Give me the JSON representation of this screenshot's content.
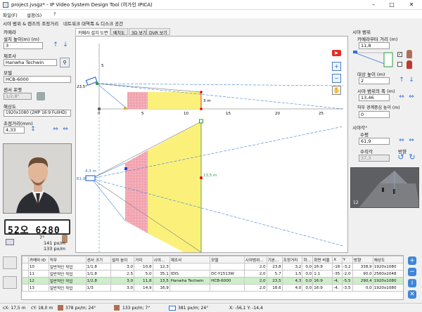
{
  "window": {
    "title": "project.jvsgz* - IP Video System Design Tool (어가인 IPICA)",
    "min": "–",
    "max": "□",
    "close": "✕"
  },
  "menu": [
    "파일(F)",
    "설정(S)",
    "?"
  ],
  "section_tabs": [
    "시야 범위 & 렌즈의 조정거리",
    "네트워크 대역폭 & 디스크 공간"
  ],
  "left": {
    "camera_title": "카메라",
    "install_height_label": "설치 높이(m) (m)",
    "install_height_value": "3",
    "maker_label": "제조사",
    "maker_value": "Hanwha Techwin",
    "model_label": "모델",
    "model_value": "HCB-6000",
    "sensor_label": "센서 포맷",
    "sensor_value": "1/2,8\"",
    "resolution_label": "해상도",
    "resolution_value": "1920x1080 (2MP 16:9 FullHD)",
    "focal_label": "초점거리(mm)",
    "focal_value": "4,33",
    "plate_text": "52오 6280",
    "preview_angle": "7°",
    "preview_density1": "141 px/m",
    "preview_density2": "133 px/m"
  },
  "view_tabs": [
    "카메라 설치 도면",
    "배치도",
    "3D 보기",
    "DVR 보기"
  ],
  "side_view": {
    "tilt_label": "23,5°",
    "height_tick": "5",
    "x_ticks": [
      "0",
      "5",
      "10",
      "15",
      "20",
      "25"
    ],
    "dist_label": "3 m"
  },
  "top_view": {
    "left_dist": "4,3 m",
    "left_angle": "61,9°",
    "width_label": "13,5 m"
  },
  "right": {
    "fov_title": "시야 범위",
    "cam_dist_label": "카메라부터 거리 (m)",
    "cam_dist_value": "11,8",
    "target_height_label": "대상 높이 (m)",
    "target_height_value": "2",
    "fov_width_label": "시야 범위의 폭 (m)",
    "fov_width_value": "13,46",
    "lower_boundary_label": "하부 경계중심 높이 (m)",
    "lower_boundary_value": "0",
    "angle_title": "시야각°",
    "horizontal_label": "수평",
    "horizontal_value": "61,9",
    "vertical_label": "수직각",
    "vertical_value": "37,3",
    "direction_label": "방향",
    "preview_num": "12"
  },
  "table": {
    "headers": [
      "",
      "카메라 ID",
      "직무",
      "센서 크기",
      "설치 높이",
      "거리",
      "시야...",
      "제조사",
      "모델",
      "시야범위...",
      "기본...",
      "조정거리",
      "하...",
      "화면 비율",
      "X",
      "Y",
      "방향",
      "해상도"
    ],
    "rows": [
      [
        "",
        "10",
        "일반적인 작업",
        "1/1,8",
        "3,0",
        "10,8",
        "12,3",
        "",
        "",
        "2,0",
        "23,8",
        "3,2",
        "0,0",
        "16:9",
        "-18",
        "-3,2",
        "338,9",
        "1920x1080"
      ],
      [
        "",
        "11",
        "일반적인 작업",
        "1/1,8",
        "2,5",
        "5,0",
        "35,1",
        "IDIS",
        "DC-Y1513W",
        "2,0",
        "5,7",
        "1,5",
        "0,0",
        "1:1",
        "-35",
        "-2,0",
        "90,0",
        "2560x2048"
      ],
      [
        "",
        "12",
        "일반적인 작업",
        "1/2,8",
        "3,0",
        "11,8",
        "13,5",
        "Hanwha Techwin",
        "HCB-6000",
        "2,0",
        "23,5",
        "4,3",
        "0,0",
        "16:9",
        "-4,",
        "-5,5",
        "290,4",
        "1920x1080"
      ],
      [
        "",
        "13",
        "일반적인 작업",
        "1/3",
        "3,0",
        "14,9",
        "16,9",
        "",
        "",
        "2,0",
        "18,6",
        "4,0",
        "0,0",
        "16:9",
        "-4,",
        "-3,5",
        "0,0",
        "1920x1080"
      ]
    ]
  },
  "status": {
    "cx": "cX: 17,5 m",
    "cy": "cY: 18,0 m",
    "d1": "378 px/m; 24°",
    "d2": "133 px/m; 7°",
    "d3": "381 px/m; 24°",
    "xy": "X: -56,1  Y: -14,4"
  },
  "colors": {
    "red_zone": "#f1a1ad",
    "yellow_zone": "#fbf17a",
    "accent": "#2f6fd6"
  }
}
